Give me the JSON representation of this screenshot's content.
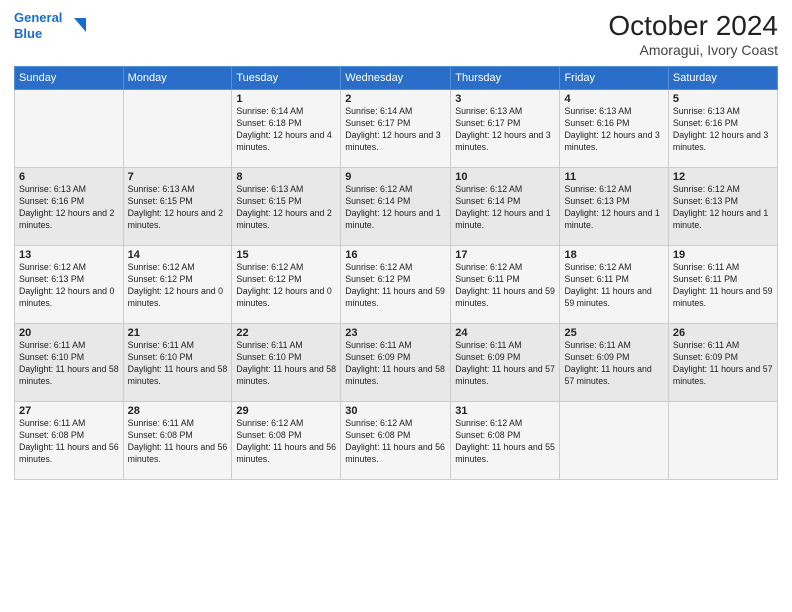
{
  "header": {
    "logo_line1": "General",
    "logo_line2": "Blue",
    "title": "October 2024",
    "subtitle": "Amoragui, Ivory Coast"
  },
  "days_of_week": [
    "Sunday",
    "Monday",
    "Tuesday",
    "Wednesday",
    "Thursday",
    "Friday",
    "Saturday"
  ],
  "weeks": [
    [
      {
        "day": "",
        "info": ""
      },
      {
        "day": "",
        "info": ""
      },
      {
        "day": "1",
        "info": "Sunrise: 6:14 AM\nSunset: 6:18 PM\nDaylight: 12 hours and 4 minutes."
      },
      {
        "day": "2",
        "info": "Sunrise: 6:14 AM\nSunset: 6:17 PM\nDaylight: 12 hours and 3 minutes."
      },
      {
        "day": "3",
        "info": "Sunrise: 6:13 AM\nSunset: 6:17 PM\nDaylight: 12 hours and 3 minutes."
      },
      {
        "day": "4",
        "info": "Sunrise: 6:13 AM\nSunset: 6:16 PM\nDaylight: 12 hours and 3 minutes."
      },
      {
        "day": "5",
        "info": "Sunrise: 6:13 AM\nSunset: 6:16 PM\nDaylight: 12 hours and 3 minutes."
      }
    ],
    [
      {
        "day": "6",
        "info": "Sunrise: 6:13 AM\nSunset: 6:16 PM\nDaylight: 12 hours and 2 minutes."
      },
      {
        "day": "7",
        "info": "Sunrise: 6:13 AM\nSunset: 6:15 PM\nDaylight: 12 hours and 2 minutes."
      },
      {
        "day": "8",
        "info": "Sunrise: 6:13 AM\nSunset: 6:15 PM\nDaylight: 12 hours and 2 minutes."
      },
      {
        "day": "9",
        "info": "Sunrise: 6:12 AM\nSunset: 6:14 PM\nDaylight: 12 hours and 1 minute."
      },
      {
        "day": "10",
        "info": "Sunrise: 6:12 AM\nSunset: 6:14 PM\nDaylight: 12 hours and 1 minute."
      },
      {
        "day": "11",
        "info": "Sunrise: 6:12 AM\nSunset: 6:13 PM\nDaylight: 12 hours and 1 minute."
      },
      {
        "day": "12",
        "info": "Sunrise: 6:12 AM\nSunset: 6:13 PM\nDaylight: 12 hours and 1 minute."
      }
    ],
    [
      {
        "day": "13",
        "info": "Sunrise: 6:12 AM\nSunset: 6:13 PM\nDaylight: 12 hours and 0 minutes."
      },
      {
        "day": "14",
        "info": "Sunrise: 6:12 AM\nSunset: 6:12 PM\nDaylight: 12 hours and 0 minutes."
      },
      {
        "day": "15",
        "info": "Sunrise: 6:12 AM\nSunset: 6:12 PM\nDaylight: 12 hours and 0 minutes."
      },
      {
        "day": "16",
        "info": "Sunrise: 6:12 AM\nSunset: 6:12 PM\nDaylight: 11 hours and 59 minutes."
      },
      {
        "day": "17",
        "info": "Sunrise: 6:12 AM\nSunset: 6:11 PM\nDaylight: 11 hours and 59 minutes."
      },
      {
        "day": "18",
        "info": "Sunrise: 6:12 AM\nSunset: 6:11 PM\nDaylight: 11 hours and 59 minutes."
      },
      {
        "day": "19",
        "info": "Sunrise: 6:11 AM\nSunset: 6:11 PM\nDaylight: 11 hours and 59 minutes."
      }
    ],
    [
      {
        "day": "20",
        "info": "Sunrise: 6:11 AM\nSunset: 6:10 PM\nDaylight: 11 hours and 58 minutes."
      },
      {
        "day": "21",
        "info": "Sunrise: 6:11 AM\nSunset: 6:10 PM\nDaylight: 11 hours and 58 minutes."
      },
      {
        "day": "22",
        "info": "Sunrise: 6:11 AM\nSunset: 6:10 PM\nDaylight: 11 hours and 58 minutes."
      },
      {
        "day": "23",
        "info": "Sunrise: 6:11 AM\nSunset: 6:09 PM\nDaylight: 11 hours and 58 minutes."
      },
      {
        "day": "24",
        "info": "Sunrise: 6:11 AM\nSunset: 6:09 PM\nDaylight: 11 hours and 57 minutes."
      },
      {
        "day": "25",
        "info": "Sunrise: 6:11 AM\nSunset: 6:09 PM\nDaylight: 11 hours and 57 minutes."
      },
      {
        "day": "26",
        "info": "Sunrise: 6:11 AM\nSunset: 6:09 PM\nDaylight: 11 hours and 57 minutes."
      }
    ],
    [
      {
        "day": "27",
        "info": "Sunrise: 6:11 AM\nSunset: 6:08 PM\nDaylight: 11 hours and 56 minutes."
      },
      {
        "day": "28",
        "info": "Sunrise: 6:11 AM\nSunset: 6:08 PM\nDaylight: 11 hours and 56 minutes."
      },
      {
        "day": "29",
        "info": "Sunrise: 6:12 AM\nSunset: 6:08 PM\nDaylight: 11 hours and 56 minutes."
      },
      {
        "day": "30",
        "info": "Sunrise: 6:12 AM\nSunset: 6:08 PM\nDaylight: 11 hours and 56 minutes."
      },
      {
        "day": "31",
        "info": "Sunrise: 6:12 AM\nSunset: 6:08 PM\nDaylight: 11 hours and 55 minutes."
      },
      {
        "day": "",
        "info": ""
      },
      {
        "day": "",
        "info": ""
      }
    ]
  ]
}
